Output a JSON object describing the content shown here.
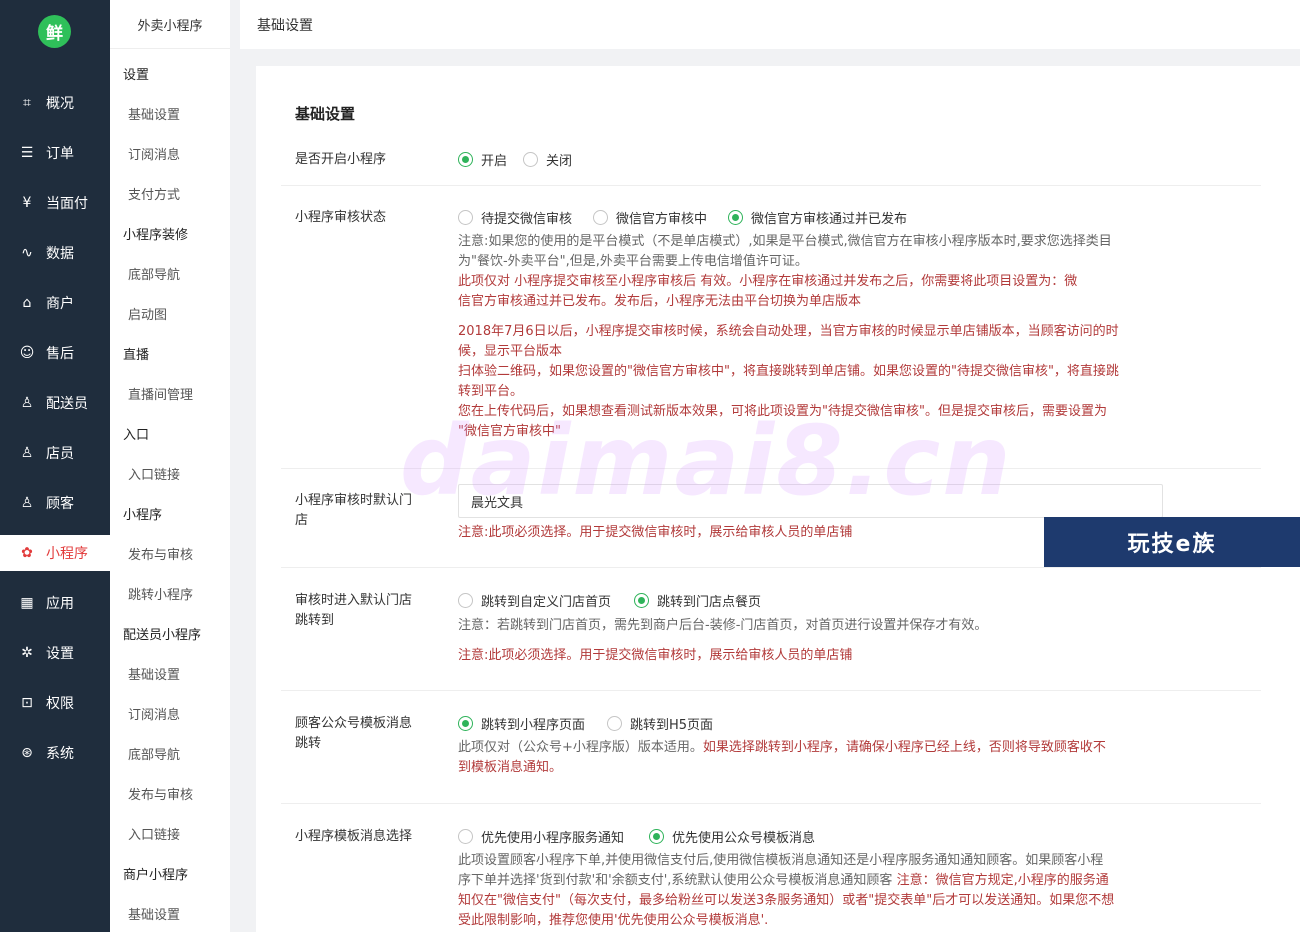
{
  "nav": {
    "logo": "鲜",
    "items": [
      {
        "label": "概况",
        "icon": "⌗"
      },
      {
        "label": "订单",
        "icon": "☰"
      },
      {
        "label": "当面付",
        "icon": "¥"
      },
      {
        "label": "数据",
        "icon": "∿"
      },
      {
        "label": "商户",
        "icon": "⌂"
      },
      {
        "label": "售后",
        "icon": "☺"
      },
      {
        "label": "配送员",
        "icon": "♙"
      },
      {
        "label": "店员",
        "icon": "♙"
      },
      {
        "label": "顾客",
        "icon": "♙"
      },
      {
        "label": "小程序",
        "icon": "✿"
      },
      {
        "label": "应用",
        "icon": "▦"
      },
      {
        "label": "设置",
        "icon": "✲"
      },
      {
        "label": "权限",
        "icon": "⊡"
      },
      {
        "label": "系统",
        "icon": "⊛"
      }
    ]
  },
  "sub": {
    "top": "外卖小程序",
    "entries": [
      {
        "type": "grp",
        "label": "设置"
      },
      {
        "type": "lnk",
        "label": "基础设置"
      },
      {
        "type": "lnk",
        "label": "订阅消息"
      },
      {
        "type": "lnk",
        "label": "支付方式"
      },
      {
        "type": "grp",
        "label": "小程序装修"
      },
      {
        "type": "lnk",
        "label": "底部导航"
      },
      {
        "type": "lnk",
        "label": "启动图"
      },
      {
        "type": "grp",
        "label": "直播"
      },
      {
        "type": "lnk",
        "label": "直播间管理"
      },
      {
        "type": "grp",
        "label": "入口"
      },
      {
        "type": "lnk",
        "label": "入口链接"
      },
      {
        "type": "grp",
        "label": "小程序"
      },
      {
        "type": "lnk",
        "label": "发布与审核"
      },
      {
        "type": "lnk",
        "label": "跳转小程序"
      },
      {
        "type": "grp",
        "label": "配送员小程序"
      },
      {
        "type": "lnk",
        "label": "基础设置"
      },
      {
        "type": "lnk",
        "label": "订阅消息"
      },
      {
        "type": "lnk",
        "label": "底部导航"
      },
      {
        "type": "lnk",
        "label": "发布与审核"
      },
      {
        "type": "lnk",
        "label": "入口链接"
      },
      {
        "type": "grp",
        "label": "商户小程序"
      },
      {
        "type": "lnk",
        "label": "基础设置"
      }
    ]
  },
  "header": {
    "title": "基础设置"
  },
  "card": {
    "title": "基础设置",
    "enable": {
      "label": "是否开启小程序",
      "on": "开启",
      "off": "关闭"
    },
    "review": {
      "label": "小程序审核状态",
      "opt1": "待提交微信审核",
      "opt2": "微信官方审核中",
      "opt3": "微信官方审核通过并已发布",
      "n1": "注意:如果您的使用的是平台模式（不是单店模式）,如果是平台模式,微信官方在审核小程序版本时,要求您选择类目",
      "n2": "为\"餐饮-外卖平台\",但是,外卖平台需要上传电信增值许可证。",
      "n3": "此项仅对 小程序提交审核至小程序审核后 有效。小程序在审核通过并发布之后，你需要将此项目设置为：微",
      "n4": "信官方审核通过并已发布。发布后，小程序无法由平台切换为单店版本",
      "n5": "2018年7月6日以后，小程序提交审核时候，系统会自动处理，当官方审核的时候显示单店铺版本，当顾客访问的时",
      "n6": "候，显示平台版本",
      "n7": "扫体验二维码，如果您设置的\"微信官方审核中\"，将直接跳转到单店铺。如果您设置的\"待提交微信审核\"，将直接跳",
      "n8": "转到平台。",
      "n9": "您在上传代码后，如果想查看测试新版本效果，可将此项设置为\"待提交微信审核\"。但是提交审核后，需要设置为",
      "n10": "\"微信官方审核中\""
    },
    "defaultStore": {
      "label1": "小程序审核时默认门",
      "label2": "店",
      "value": "晨光文具",
      "note": "注意:此项必须选择。用于提交微信审核时，展示给审核人员的单店铺"
    },
    "jump": {
      "label1": "审核时进入默认门店",
      "label2": "跳转到",
      "opt1": "跳转到自定义门店首页",
      "opt2": "跳转到门店点餐页",
      "note1": "注意：若跳转到门店首页，需先到商户后台-装修-门店首页，对首页进行设置并保存才有效。",
      "note2": "注意:此项必须选择。用于提交微信审核时，展示给审核人员的单店铺"
    },
    "tpl": {
      "label1": "顾客公众号模板消息",
      "label2": "跳转",
      "opt1": "跳转到小程序页面",
      "opt2": "跳转到H5页面",
      "n1a": "此项仅对（公众号+小程序版）版本适用。",
      "n1b": "如果选择跳转到小程序，请确保小程序已经上线，否则将导致顾客收不",
      "n2": "到模板消息通知。"
    },
    "msg": {
      "label": "小程序模板消息选择",
      "opt1": "优先使用小程序服务通知",
      "opt2": "优先使用公众号模板消息",
      "n1": "此项设置顾客小程序下单,并使用微信支付后,使用微信模板消息通知还是小程序服务通知通知顾客。如果顾客小程",
      "n2a": "序下单并选择'货到付款'和'余额支付',系统默认使用公众号模板消息通知顾客",
      "n2b": " 注意：微信官方规定,小程序的服务通",
      "n3": "知仅在\"微信支付\"（每次支付，最多给粉丝可以发送3条服务通知）或者\"提交表单\"后才可以发送通知。如果您不想",
      "n4": "受此限制影响，推荐您使用'优先使用公众号模板消息'."
    }
  },
  "watermark": "daimai8.cn",
  "badge": "玩技e族",
  "colors": {
    "nav_bg": "#1f2d3d",
    "accent_green": "#2fb35a",
    "warn_red": "#b23a3a",
    "active_red": "#e23b3b"
  }
}
